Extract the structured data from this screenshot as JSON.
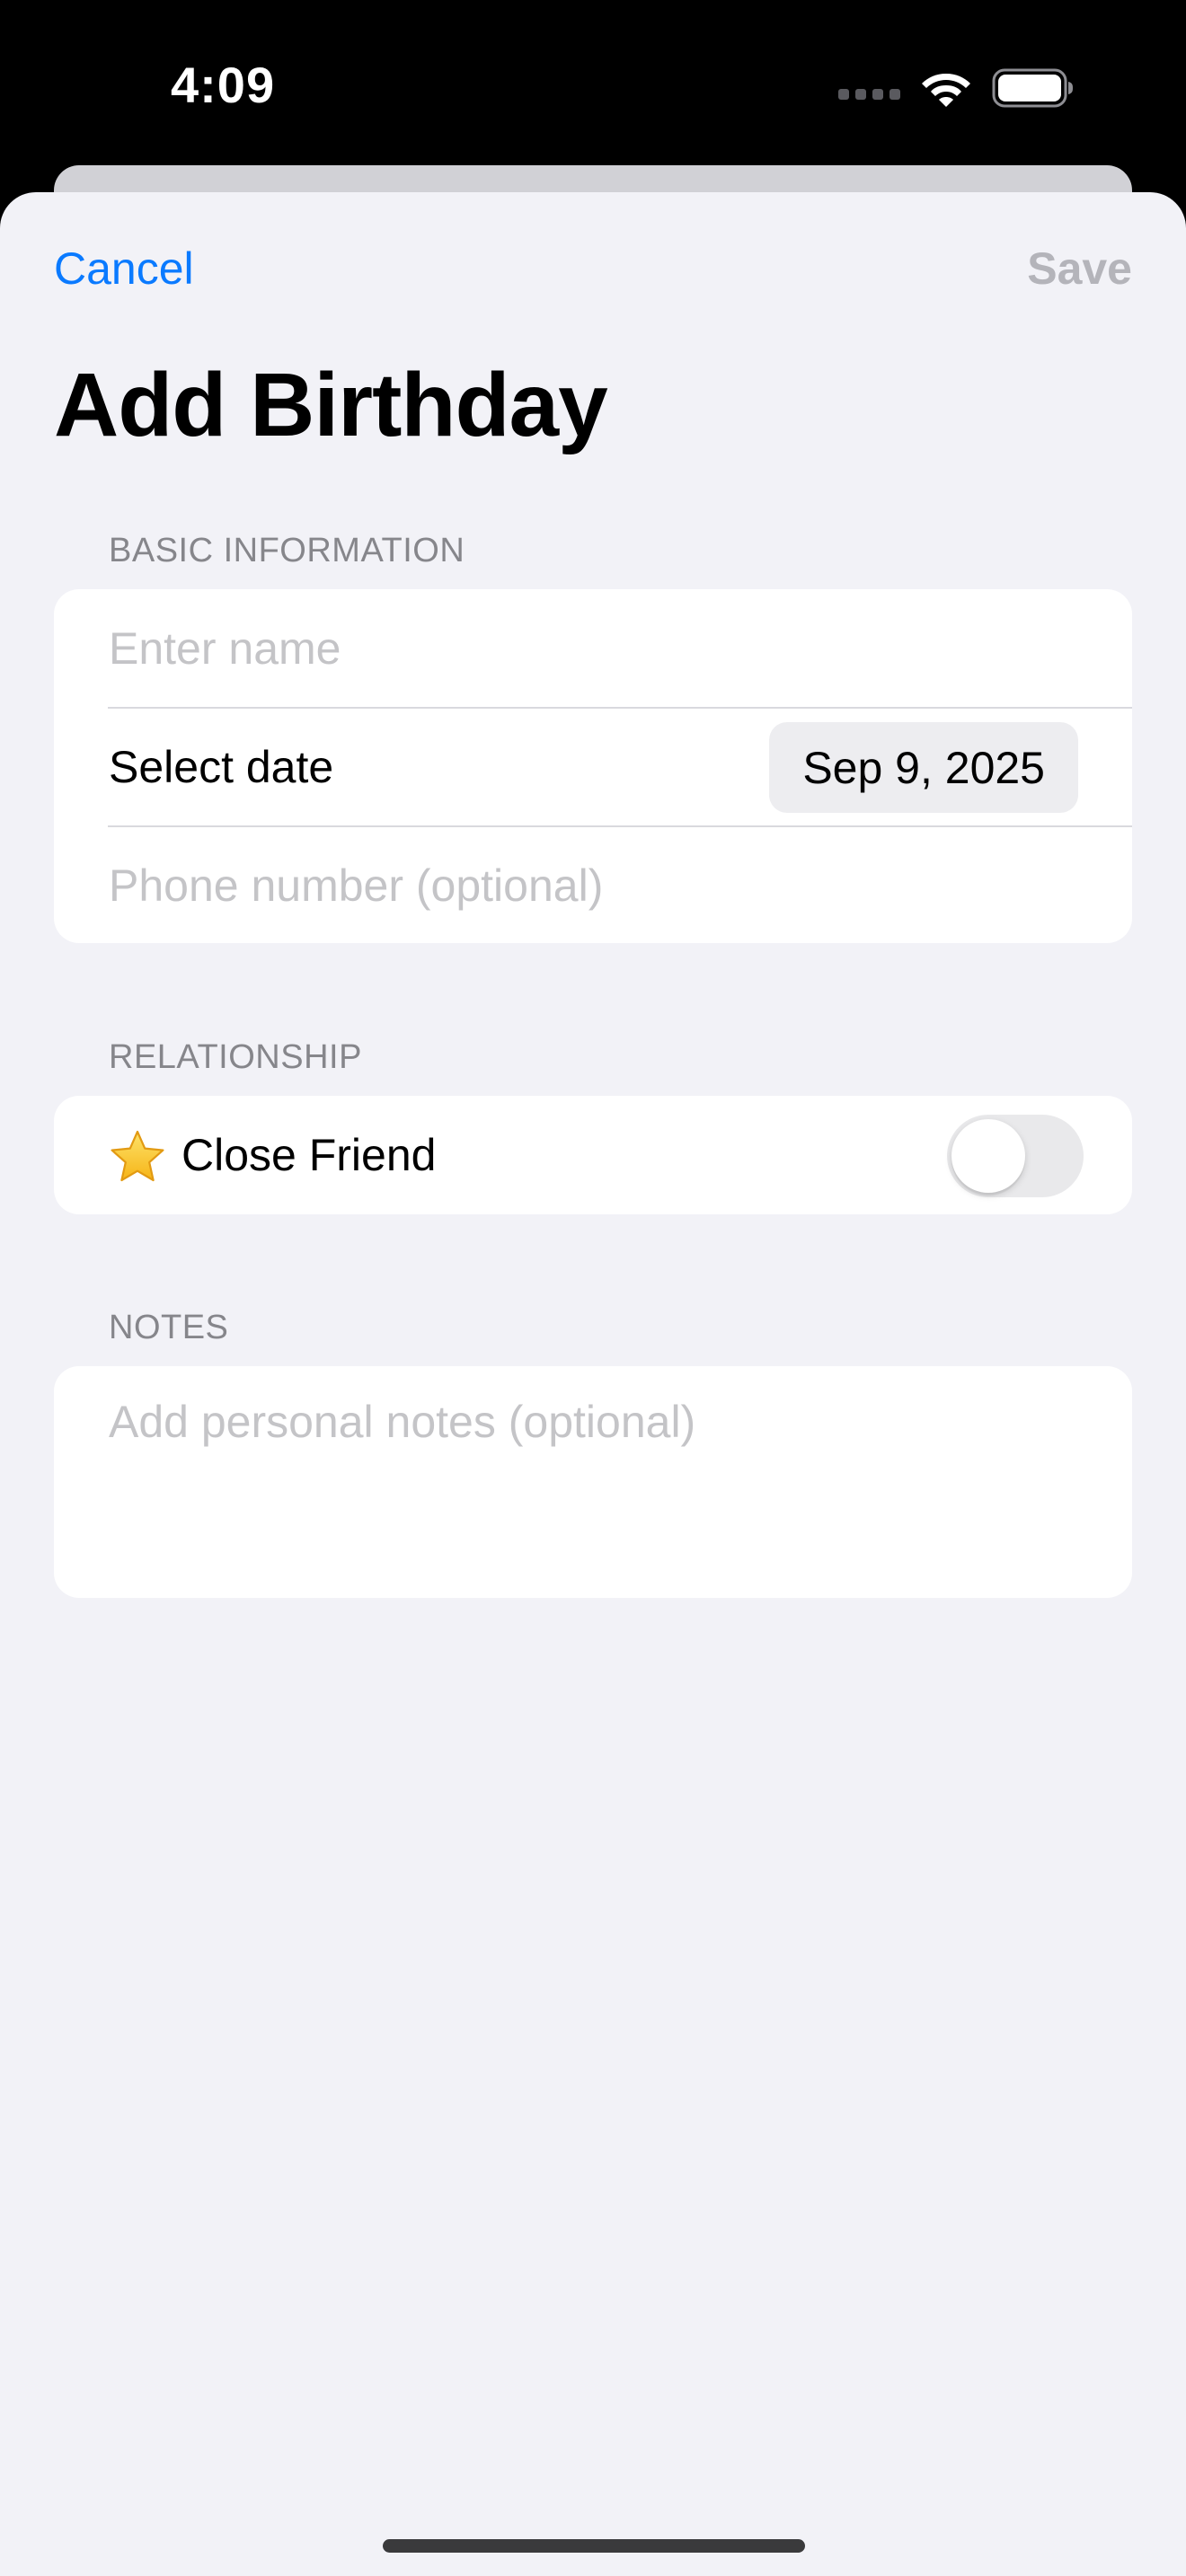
{
  "status_bar": {
    "time": "4:09",
    "icons": [
      "cellular-signal-icon",
      "wifi-icon",
      "battery-icon"
    ]
  },
  "navigation": {
    "cancel_label": "Cancel",
    "save_label": "Save",
    "save_enabled": false
  },
  "page": {
    "title": "Add Birthday"
  },
  "sections": {
    "basic_information": {
      "header": "BASIC INFORMATION",
      "name_field": {
        "value": "",
        "placeholder": "Enter name"
      },
      "date_row": {
        "label": "Select date",
        "value": "Sep 9, 2025"
      },
      "phone_field": {
        "value": "",
        "placeholder": "Phone number (optional)"
      }
    },
    "relationship": {
      "header": "RELATIONSHIP",
      "close_friend": {
        "icon": "star-icon",
        "label": "Close Friend",
        "enabled": false
      }
    },
    "notes": {
      "header": "NOTES",
      "field": {
        "value": "",
        "placeholder": "Add personal notes (optional)"
      }
    }
  },
  "colors": {
    "accent": "#0a7aff",
    "disabled": "#b4b4ba",
    "background": "#f2f2f7",
    "card": "#ffffff",
    "section_header": "#86868b",
    "placeholder": "#c4c4c7",
    "toggle_off": "#e9e9eb"
  }
}
